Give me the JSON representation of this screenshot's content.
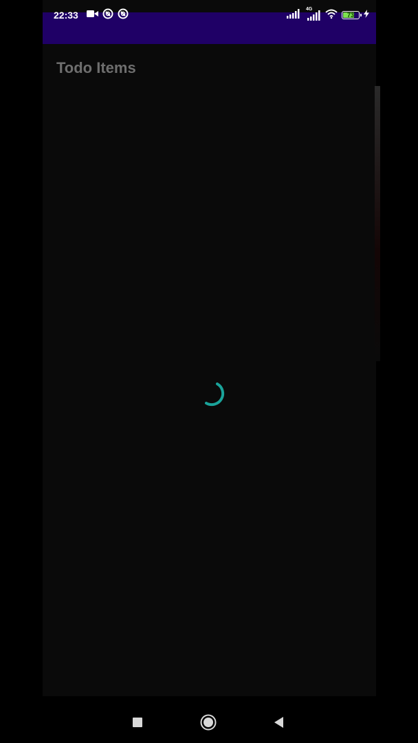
{
  "status_bar": {
    "time": "22:33",
    "battery_level": "73",
    "battery_fraction": 0.73,
    "network_type": "4G",
    "background_color": "#1f0066",
    "icons_left": [
      "video-camera-icon",
      "sync-circle-icon",
      "sync-circle-icon"
    ],
    "icons_right": [
      "signal-icon",
      "signal-4g-icon",
      "wifi-icon",
      "battery-icon",
      "charging-bolt-icon"
    ]
  },
  "main": {
    "title": "Todo Items",
    "loading": true,
    "spinner_color": "#1aa39a"
  },
  "nav_bar": {
    "buttons": [
      "recents-button",
      "home-button",
      "back-button"
    ]
  }
}
